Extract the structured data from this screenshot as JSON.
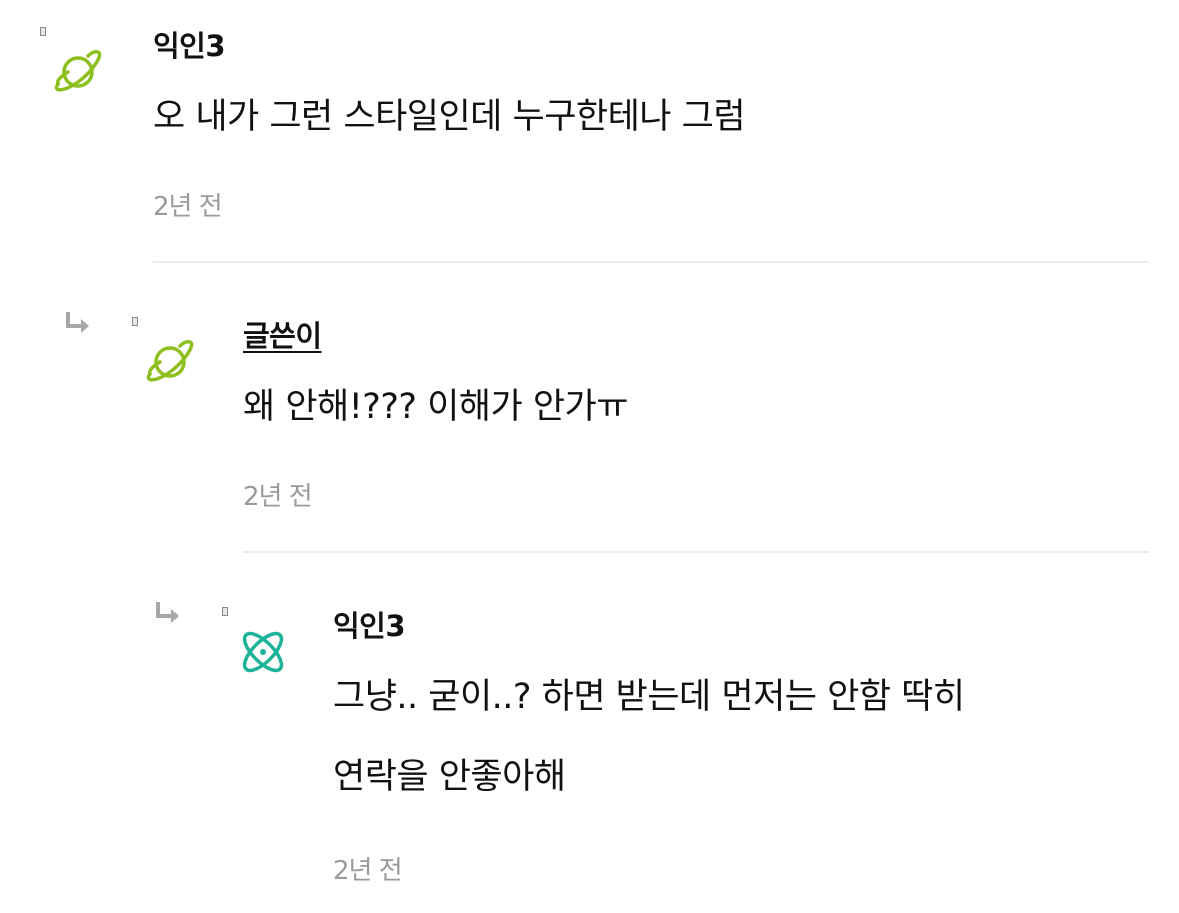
{
  "comments": [
    {
      "author": "익인3",
      "avatar_icon": "planet-icon",
      "avatar_color": "#8dbf1f",
      "text_lines": [
        "오 내가 그런 스타일인데 누구한테나 그럼"
      ],
      "time": "2년 전"
    },
    {
      "author": "글쓴이",
      "avatar_icon": "planet-icon",
      "avatar_color": "#8dbf1f",
      "text_lines": [
        "왜 안해!??? 이해가 안가ㅠ"
      ],
      "time": "2년 전"
    },
    {
      "author": "익인3",
      "avatar_icon": "atom-icon",
      "avatar_color": "#1db39a",
      "text_lines": [
        "그냥.. 굳이..? 하면 받는데 먼저는 안함 딱히",
        "연락을 안좋아해"
      ],
      "time": "2년 전"
    }
  ]
}
